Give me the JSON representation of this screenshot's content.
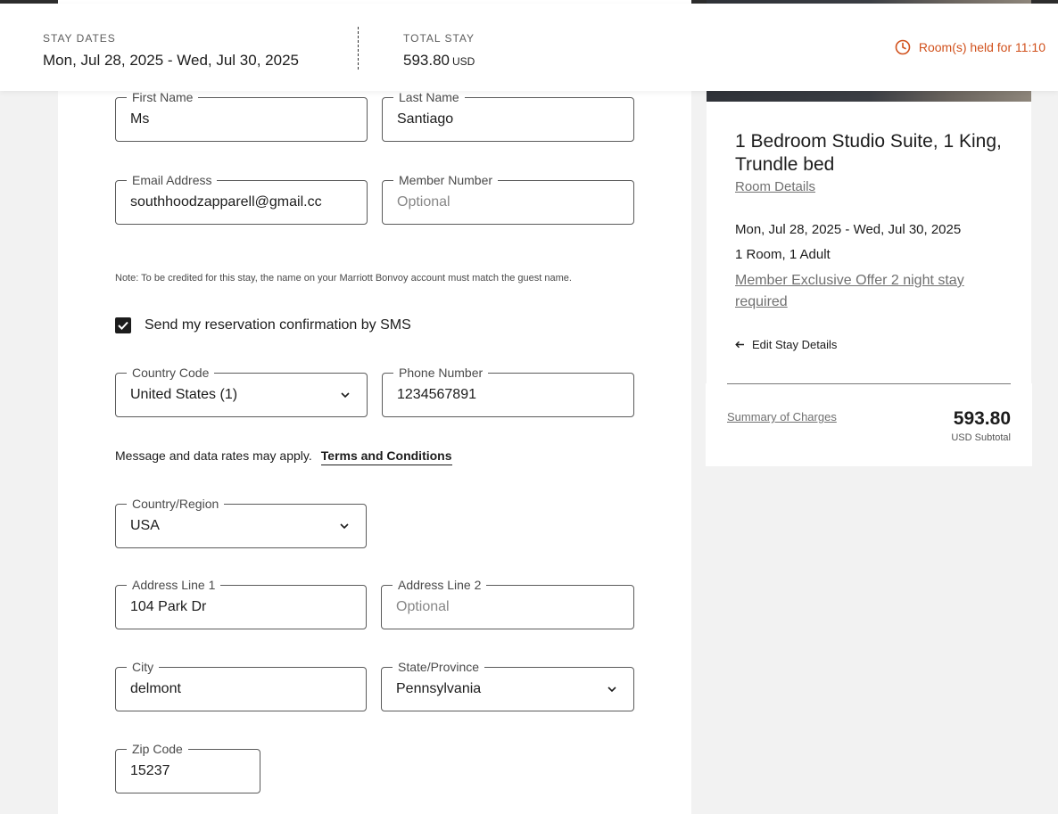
{
  "header": {
    "stay_dates_label": "STAY DATES",
    "stay_dates_value": "Mon, Jul 28, 2025 - Wed, Jul 30, 2025",
    "total_label": "TOTAL STAY",
    "total_amount": "593.80",
    "total_currency": "USD",
    "timer_text": "Room(s) held for 11:10",
    "timer_icon": "clock-icon",
    "accent_color": "#d1511c"
  },
  "form": {
    "first_name": {
      "label": "First Name",
      "value": "Ms"
    },
    "last_name": {
      "label": "Last Name",
      "value": "Santiago"
    },
    "email": {
      "label": "Email Address",
      "value": "southhoodzapparell@gmail.cc"
    },
    "member_number": {
      "label": "Member Number",
      "placeholder": "Optional"
    },
    "note": "Note: To be credited for this stay, the name on your Marriott Bonvoy account must match the guest name.",
    "sms_label": "Send my reservation confirmation by SMS",
    "sms_checked": true,
    "country_code": {
      "label": "Country Code",
      "value": "United States (1)"
    },
    "phone": {
      "label": "Phone Number",
      "value": "1234567891"
    },
    "rates_text": "Message and data rates may apply.",
    "terms_link": "Terms and Conditions",
    "country_region": {
      "label": "Country/Region",
      "value": "USA"
    },
    "address1": {
      "label": "Address Line 1",
      "value": "104 Park Dr"
    },
    "address2": {
      "label": "Address Line 2",
      "placeholder": "Optional"
    },
    "city": {
      "label": "City",
      "value": "delmont"
    },
    "state": {
      "label": "State/Province",
      "value": "Pennsylvania"
    },
    "zip": {
      "label": "Zip Code",
      "value": "15237"
    }
  },
  "summary": {
    "room_title": "1 Bedroom Studio Suite, 1 King, Trundle bed",
    "room_details_link": "Room Details",
    "dates": "Mon, Jul 28, 2025 - Wed, Jul 30, 2025",
    "guests": "1 Room, 1 Adult",
    "offer_link": "Member Exclusive Offer 2 night stay required",
    "edit_label": "Edit Stay Details",
    "charges_link": "Summary of Charges",
    "total_amount": "593.80",
    "total_sub": "USD Subtotal"
  }
}
